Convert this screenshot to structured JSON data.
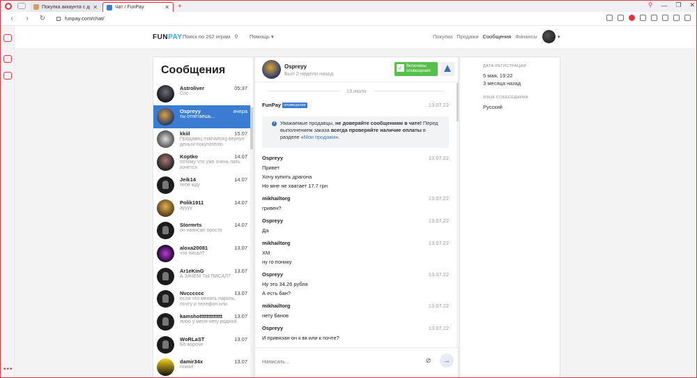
{
  "browser": {
    "tabs": [
      {
        "title": "Покупка аккаунта с драгона",
        "active": false
      },
      {
        "title": "Чат / FunPay",
        "active": true
      }
    ],
    "url": "funpay.com/chat/"
  },
  "header": {
    "logo_a": "FUN",
    "logo_b": "PAY",
    "search_label": "Поиск по 262 играм",
    "help_label": "Помощь",
    "nav": [
      "Покупки",
      "Продажи",
      "Сообщения",
      "Финансы"
    ],
    "nav_active": "Сообщения"
  },
  "sidebar": {
    "title": "Сообщения",
    "contacts": [
      {
        "name": "Astroliver",
        "time": "05:37",
        "preview": "Спс"
      },
      {
        "name": "Ospreyy",
        "time": "вчера",
        "preview": "ты отпетаешь..."
      },
      {
        "name": "kkiil",
        "time": "15.07",
        "preview": "Продавец mikhailtorg вернул деньги покупателю"
      },
      {
        "name": "Koptko",
        "time": "14.07",
        "preview": "потому что уже очень пать хочется"
      },
      {
        "name": "Jeik14",
        "time": "14.07",
        "preview": "тебя жду"
      },
      {
        "name": "Polik1911",
        "time": "14.07",
        "preview": "ауууу"
      },
      {
        "name": "Stormrts",
        "time": "14.07",
        "preview": "он написал просто"
      },
      {
        "name": "aloxa20081",
        "time": "13.07",
        "preview": "что писал?"
      },
      {
        "name": "Ar1eKinG",
        "time": "13.07",
        "preview": "А ЗАЧЕМ ТЫ ПИСАЛ?"
      },
      {
        "name": "Nvcccccc",
        "time": "13.07",
        "preview": "если что менять пароль, почту и телефон или"
      },
      {
        "name": "kamshottttttttttttt",
        "time": "13.07",
        "preview": "либо у меня нету родной"
      },
      {
        "name": "WoRLaST",
        "time": "13.07",
        "preview": "Бб вороче"
      },
      {
        "name": "damir34x",
        "time": "13.07",
        "preview": "понял"
      }
    ]
  },
  "chat": {
    "name": "Ospreyy",
    "status": "Был 2 недели назад",
    "notif_label_1": "Включены",
    "notif_label_2": "оповещения",
    "date_separator": "13 июля",
    "system": {
      "author": "FunPay",
      "badge": "оповещение",
      "date": "13.07.22",
      "t1": "Уважаемые продавцы, ",
      "b1": "не доверяйте сообщениям в чате!",
      "t2": " Перед выполнением заказа ",
      "b2": "всегда проверяйте наличие оплаты",
      "t3": " в разделе «",
      "link": "Мои продажи",
      "t4": "»."
    },
    "messages": [
      {
        "author": "Ospreyy",
        "date": "13.07.22",
        "lines": [
          "Привет",
          "Хочу купить драгона",
          "Но мне не хватает 17.7 грн"
        ]
      },
      {
        "author": "mikhailtorg",
        "date": "13.07.22",
        "lines": [
          "гривен?"
        ]
      },
      {
        "author": "Ospreyy",
        "date": "13.07.22",
        "lines": [
          "Да"
        ]
      },
      {
        "author": "mikhailtorg",
        "date": "13.07.22",
        "lines": [
          "ХМ",
          "ну го понику"
        ]
      },
      {
        "author": "Ospreyy",
        "date": "13.07.22",
        "lines": [
          "Ну это 34.26 рубля",
          "А есть бан?"
        ]
      },
      {
        "author": "mikhailtorg",
        "date": "13.07.22",
        "lines": [
          "нету банов"
        ]
      },
      {
        "author": "Ospreyy",
        "date": "13.07.22",
        "lines": [
          "И привязан он к вк или к почте?"
        ]
      }
    ],
    "input_placeholder": "Написать..."
  },
  "info": {
    "reg_label": "ДАТА РЕГИСТРАЦИИ",
    "reg_date": "5 мая, 19:22",
    "reg_ago": "3 месяца назад",
    "lang_label": "ЯЗЫК СОБЕСЕДНИКА",
    "lang": "Русский"
  },
  "colors": {
    "accent": "#3a7cd1",
    "opera_red": "#e0353f",
    "notif_green": "#57c04a"
  }
}
